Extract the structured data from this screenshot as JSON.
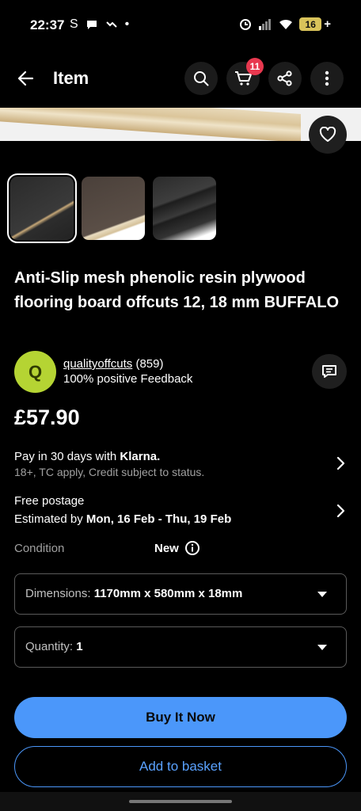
{
  "status_bar": {
    "time": "22:37",
    "left_icons": [
      "S",
      "chat-icon",
      "signal-app-icon",
      "•"
    ],
    "battery": "16"
  },
  "topbar": {
    "title": "Item",
    "cart_count": "11"
  },
  "product": {
    "title": "Anti-Slip mesh phenolic resin plywood flooring board offcuts 12, 18 mm BUFFALO",
    "price": "£57.90",
    "thumbnails": 3,
    "selected_thumbnail": 0
  },
  "seller": {
    "initial": "Q",
    "name": "qualityoffcuts",
    "score": "(859)",
    "feedback": "100% positive Feedback"
  },
  "klarna": {
    "prefix": "Pay in 30 days with",
    "brand": "Klarna.",
    "note": "18+, TC apply, Credit subject to status."
  },
  "postage": {
    "line1": "Free postage",
    "prefix": "Estimated by",
    "dates": "Mon, 16 Feb - Thu, 19 Feb"
  },
  "condition": {
    "label": "Condition",
    "value": "New"
  },
  "dimensions": {
    "label": "Dimensions:",
    "value": "1170mm x 580mm x 18mm"
  },
  "quantity": {
    "label": "Quantity:",
    "value": "1"
  },
  "actions": {
    "buy_now": "Buy It Now",
    "add_to_basket": "Add to basket"
  },
  "colors": {
    "accent": "#4b97fa",
    "badge": "#e8384f",
    "avatar": "#b5d433"
  }
}
